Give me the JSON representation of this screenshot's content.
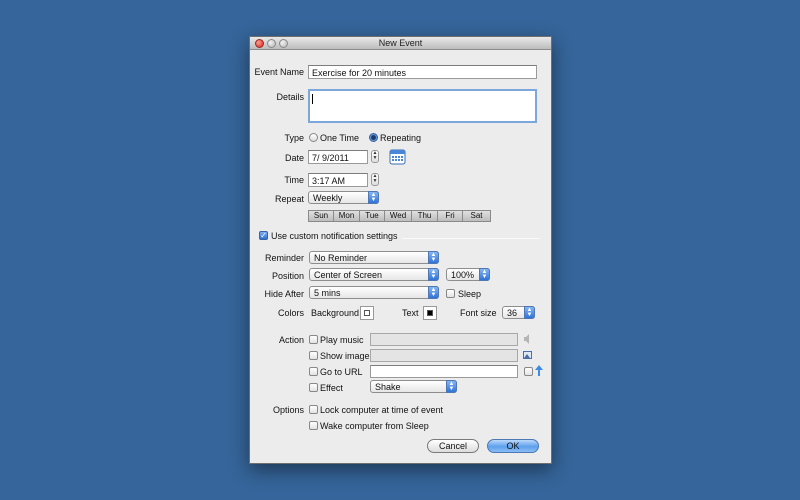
{
  "window": {
    "title": "New Event"
  },
  "event_name": {
    "label": "Event Name",
    "value": "Exercise for 20 minutes"
  },
  "details": {
    "label": "Details",
    "value": ""
  },
  "type": {
    "label": "Type",
    "options": [
      "One Time",
      "Repeating"
    ],
    "selected": "Repeating"
  },
  "date": {
    "label": "Date",
    "value": "7/  9/2011"
  },
  "time": {
    "label": "Time",
    "value": "3:17 AM"
  },
  "repeat": {
    "label": "Repeat",
    "value": "Weekly",
    "days": [
      "Sun",
      "Mon",
      "Tue",
      "Wed",
      "Thu",
      "Fri",
      "Sat"
    ]
  },
  "custom_notification": {
    "label": "Use custom notification settings",
    "checked": true
  },
  "reminder": {
    "label": "Reminder",
    "value": "No Reminder"
  },
  "position": {
    "label": "Position",
    "value": "Center of Screen",
    "scale": "100%"
  },
  "hide_after": {
    "label": "Hide After",
    "value": "5 mins",
    "sleep_label": "Sleep",
    "sleep_checked": false
  },
  "colors": {
    "label": "Colors",
    "background_label": "Background",
    "background_color": "#ffffff",
    "text_label": "Text",
    "text_color": "#000000",
    "font_size_label": "Font size",
    "font_size": "36"
  },
  "action": {
    "label": "Action",
    "play_music": "Play music",
    "show_image": "Show image",
    "go_to_url": "Go to URL",
    "effect": "Effect",
    "effect_value": "Shake"
  },
  "options": {
    "label": "Options",
    "lock": "Lock computer at time of event",
    "wake": "Wake computer from Sleep"
  },
  "buttons": {
    "cancel": "Cancel",
    "ok": "OK"
  },
  "colors_theme": {
    "desktop": "#35659a",
    "accent": "#2f73d8"
  }
}
